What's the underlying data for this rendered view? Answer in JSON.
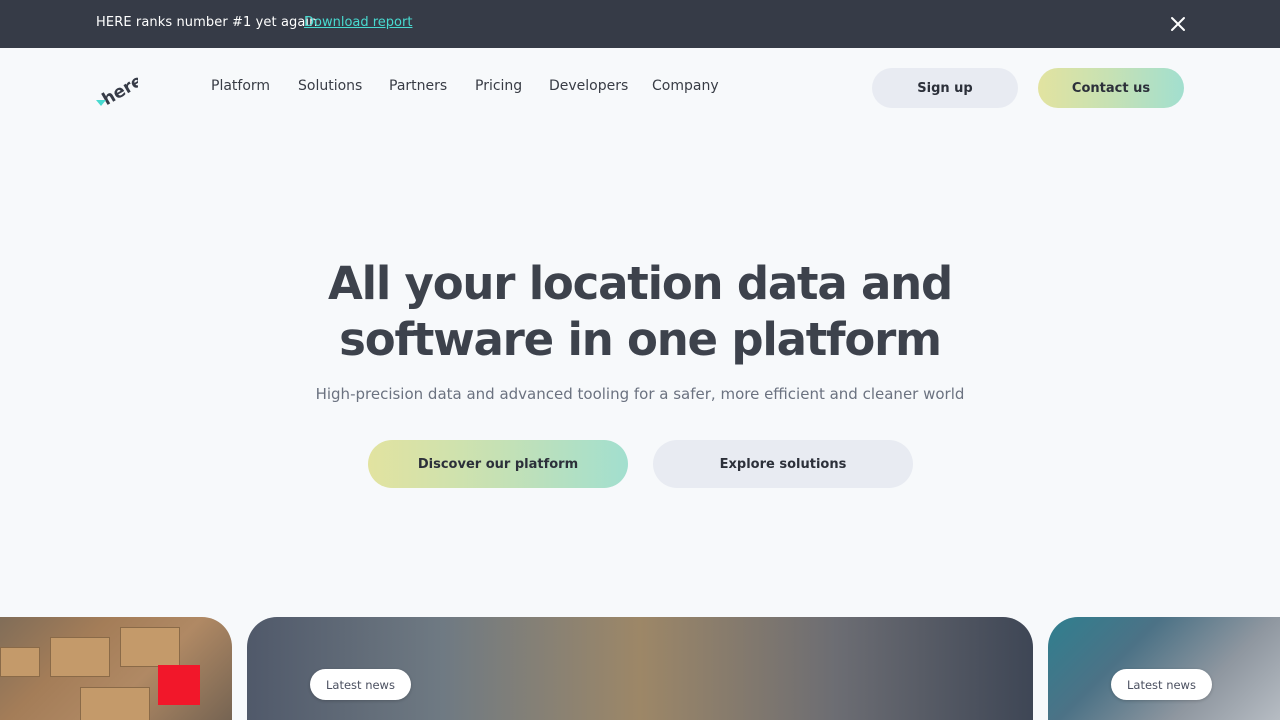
{
  "announcement": {
    "text": "HERE ranks number #1 yet again",
    "link": "Download report"
  },
  "header": {
    "logo_text": "here",
    "nav": [
      "Platform",
      "Solutions",
      "Partners",
      "Pricing",
      "Developers",
      "Company"
    ],
    "signup_label": "Sign up",
    "contact_label": "Contact us"
  },
  "hero": {
    "title_line1": "All your location data and",
    "title_line2": "software in one platform",
    "subtitle": "High-precision data and advanced tooling for a safer, more efficient and cleaner world",
    "primary_cta": "Discover our platform",
    "secondary_cta": "Explore solutions"
  },
  "cards": {
    "center_badge": "Latest news",
    "right_badge": "Latest news"
  },
  "colors": {
    "announce_bg": "#363b47",
    "link": "#48dad0",
    "page_bg": "#f7f9fb",
    "gradient_start": "#e2e3a0",
    "gradient_end": "#a2dfcf"
  }
}
